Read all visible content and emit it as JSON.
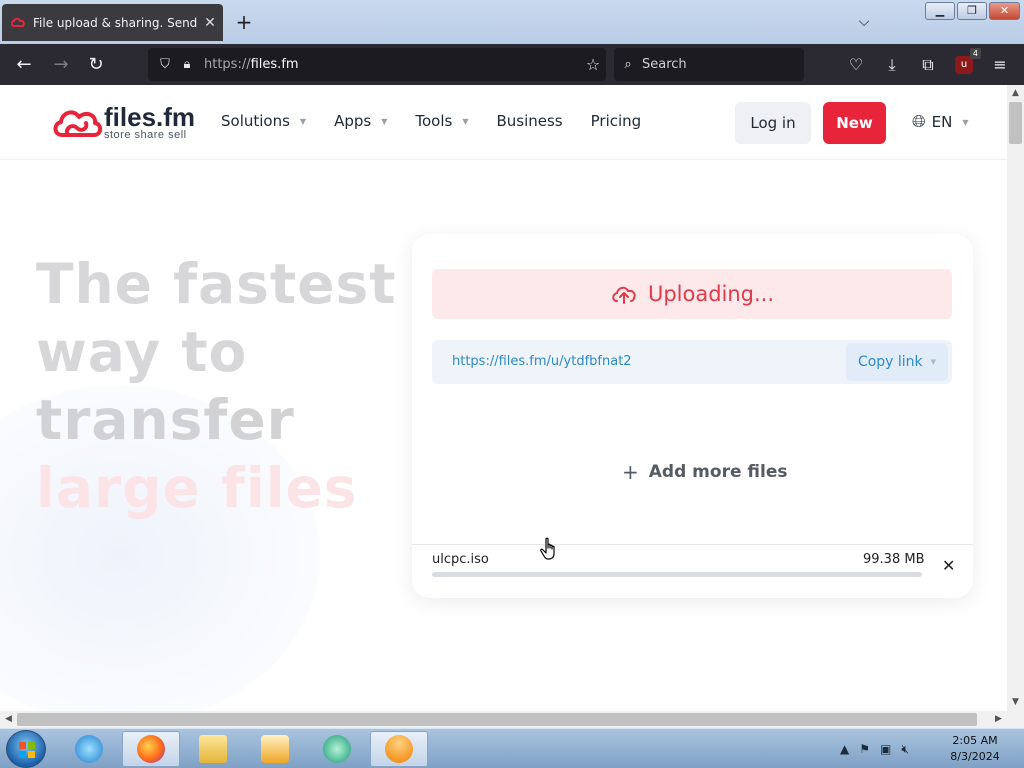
{
  "browser": {
    "tab_title": "File upload & sharing. Send large files",
    "tab_close": "✕",
    "new_tab": "+",
    "url_proto": "https://",
    "url_host": "files.fm",
    "search_placeholder": "Search",
    "ublock_count": "4"
  },
  "site": {
    "logo_name": "files.fm",
    "logo_tagline": "store  share  sell",
    "nav": [
      {
        "label": "Solutions",
        "has_caret": true
      },
      {
        "label": "Apps",
        "has_caret": true
      },
      {
        "label": "Tools",
        "has_caret": true
      },
      {
        "label": "Business",
        "has_caret": false
      },
      {
        "label": "Pricing",
        "has_caret": false
      }
    ],
    "login_label": "Log in",
    "new_label": "New",
    "language": "EN"
  },
  "hero": {
    "line1": "The fastest",
    "line2": "way to",
    "line3": "transfer",
    "line4": "large files"
  },
  "upload": {
    "status": "Uploading...",
    "share_link": "https://files.fm/u/ytdfbfnat2",
    "copy_label": "Copy link",
    "add_more_label": "Add more files",
    "file_name": "ulcpc.iso",
    "file_size": "99.38 MB",
    "progress_fraction": 1.0
  },
  "taskbar": {
    "time": "2:05 AM",
    "date": "8/3/2024"
  },
  "colors": {
    "brand_red": "#e8243b",
    "link_blue": "#2d8ac7",
    "browser_chrome": "#2b2a33"
  }
}
